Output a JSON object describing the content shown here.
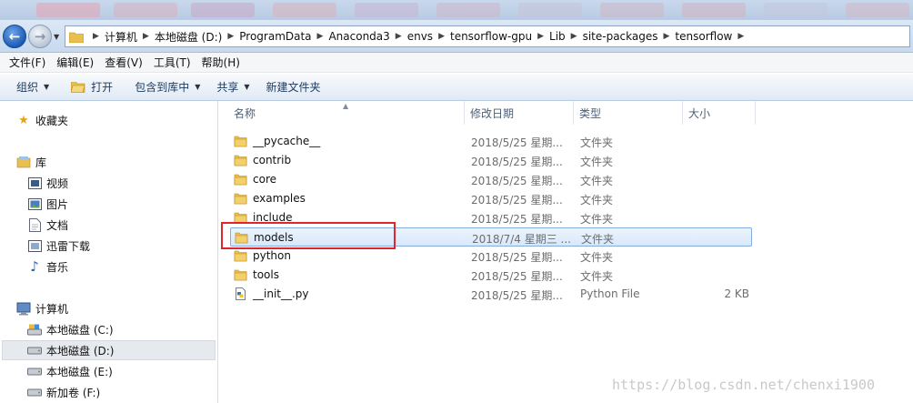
{
  "address": {
    "segments": [
      "计算机",
      "本地磁盘 (D:)",
      "ProgramData",
      "Anaconda3",
      "envs",
      "tensorflow-gpu",
      "Lib",
      "site-packages",
      "tensorflow"
    ]
  },
  "menu": {
    "file": "文件(F)",
    "edit": "编辑(E)",
    "view": "查看(V)",
    "tools": "工具(T)",
    "help": "帮助(H)"
  },
  "toolbar": {
    "organize": "组织",
    "open": "打开",
    "include_in_library": "包含到库中",
    "share": "共享",
    "new_folder": "新建文件夹"
  },
  "sidebar": {
    "favorites": "收藏夹",
    "libraries": "库",
    "videos": "视频",
    "pictures": "图片",
    "documents": "文档",
    "thunder": "迅雷下载",
    "music": "音乐",
    "computer": "计算机",
    "drive_c": "本地磁盘 (C:)",
    "drive_d": "本地磁盘 (D:)",
    "drive_e": "本地磁盘 (E:)",
    "drive_f": "新加卷 (F:)"
  },
  "columns": {
    "name": "名称",
    "modified": "修改日期",
    "type": "类型",
    "size": "大小"
  },
  "files": [
    {
      "name": "__pycache__",
      "date": "2018/5/25 星期...",
      "type": "文件夹",
      "size": "",
      "kind": "folder"
    },
    {
      "name": "contrib",
      "date": "2018/5/25 星期...",
      "type": "文件夹",
      "size": "",
      "kind": "folder"
    },
    {
      "name": "core",
      "date": "2018/5/25 星期...",
      "type": "文件夹",
      "size": "",
      "kind": "folder"
    },
    {
      "name": "examples",
      "date": "2018/5/25 星期...",
      "type": "文件夹",
      "size": "",
      "kind": "folder"
    },
    {
      "name": "include",
      "date": "2018/5/25 星期...",
      "type": "文件夹",
      "size": "",
      "kind": "folder"
    },
    {
      "name": "models",
      "date": "2018/7/4 星期三 ...",
      "type": "文件夹",
      "size": "",
      "kind": "folder"
    },
    {
      "name": "python",
      "date": "2018/5/25 星期...",
      "type": "文件夹",
      "size": "",
      "kind": "folder"
    },
    {
      "name": "tools",
      "date": "2018/5/25 星期...",
      "type": "文件夹",
      "size": "",
      "kind": "folder"
    },
    {
      "name": "__init__.py",
      "date": "2018/5/25 星期...",
      "type": "Python File",
      "size": "2 KB",
      "kind": "python"
    }
  ],
  "watermark": "https://blog.csdn.net/chenxi1900",
  "colors": {
    "highlight": "#e0262c",
    "selection": "#84acdd",
    "folder": "#e9c04f"
  }
}
